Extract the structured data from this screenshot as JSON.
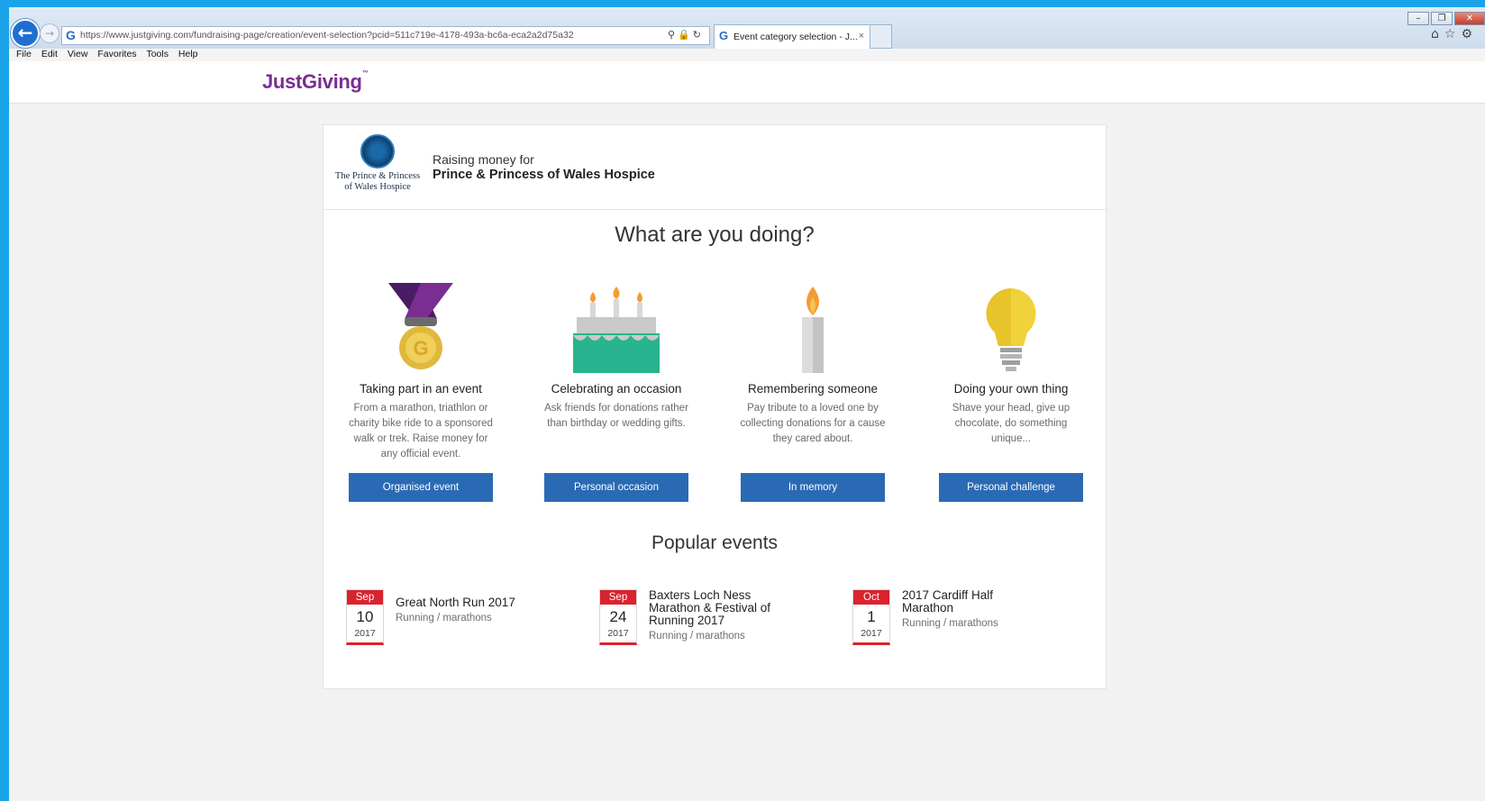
{
  "browser": {
    "url": "https://www.justgiving.com/fundraising-page/creation/event-selection?pcid=511c719e-4178-493a-bc6a-eca2a2d75a32",
    "tab_title": "Event category selection - J...",
    "tab_close": "×",
    "menu": [
      "File",
      "Edit",
      "View",
      "Favorites",
      "Tools",
      "Help"
    ],
    "icons": [
      "back-icon",
      "forward-icon",
      "search-icon",
      "lock-icon",
      "refresh-icon",
      "home-icon",
      "favorites-star-icon",
      "settings-gear-icon"
    ]
  },
  "site": {
    "logo": "JustGiving"
  },
  "charity": {
    "logo_text": "The Prince & Princess of Wales Hospice",
    "raising_label": "Raising money for",
    "name": "Prince & Princess of Wales Hospice"
  },
  "heading": "What are you doing?",
  "options": [
    {
      "title": "Taking part in an event",
      "description": "From a marathon, triathlon or charity bike ride to a sponsored walk or trek. Raise money for any official event.",
      "button": "Organised event",
      "icon": "medal-icon"
    },
    {
      "title": "Celebrating an occasion",
      "description": "Ask friends for donations rather than birthday or wedding gifts.",
      "button": "Personal occasion",
      "icon": "birthday-cake-icon"
    },
    {
      "title": "Remembering someone",
      "description": "Pay tribute to a loved one by collecting donations for a cause they cared about.",
      "button": "In memory",
      "icon": "candle-icon"
    },
    {
      "title": "Doing your own thing",
      "description": "Shave your head, give up chocolate, do something unique...",
      "button": "Personal challenge",
      "icon": "lightbulb-icon"
    }
  ],
  "popular_heading": "Popular events",
  "events": [
    {
      "month": "Sep",
      "day": "10",
      "year": "2017",
      "name": "Great North Run 2017",
      "category": "Running / marathons"
    },
    {
      "month": "Sep",
      "day": "24",
      "year": "2017",
      "name": "Baxters Loch Ness Marathon & Festival of Running 2017",
      "category": "Running / marathons"
    },
    {
      "month": "Oct",
      "day": "1",
      "year": "2017",
      "name": "2017 Cardiff Half Marathon",
      "category": "Running / marathons"
    }
  ],
  "colors": {
    "accent_purple": "#7a2e91",
    "button_blue": "#2a6ab4",
    "date_red": "#d9232e",
    "desktop_blue": "#1aa3e8"
  }
}
